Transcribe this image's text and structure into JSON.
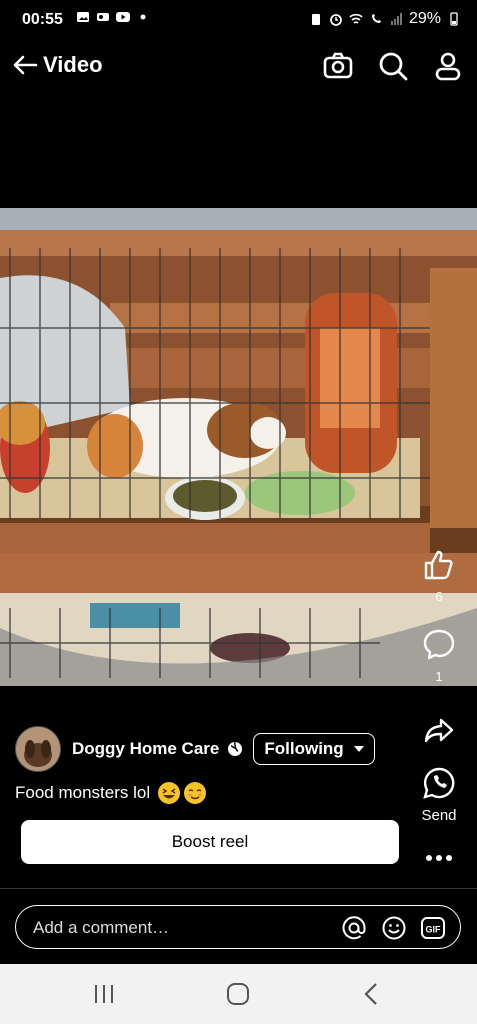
{
  "status": {
    "time": "00:55",
    "battery": "29%"
  },
  "header": {
    "title": "Video"
  },
  "actions": {
    "like_count": "6",
    "comment_count": "1",
    "send_label": "Send"
  },
  "post": {
    "author": "Doggy Home Care",
    "follow_label": "Following",
    "caption": "Food monsters lol",
    "caption_emojis": [
      "grinning-squinting-face",
      "smiling-face"
    ],
    "boost_label": "Boost reel"
  },
  "comment": {
    "placeholder": "Add a comment…"
  },
  "colors": {
    "background": "#000000",
    "boost_button": "#ffffff",
    "navbar": "#f2f2f2"
  }
}
